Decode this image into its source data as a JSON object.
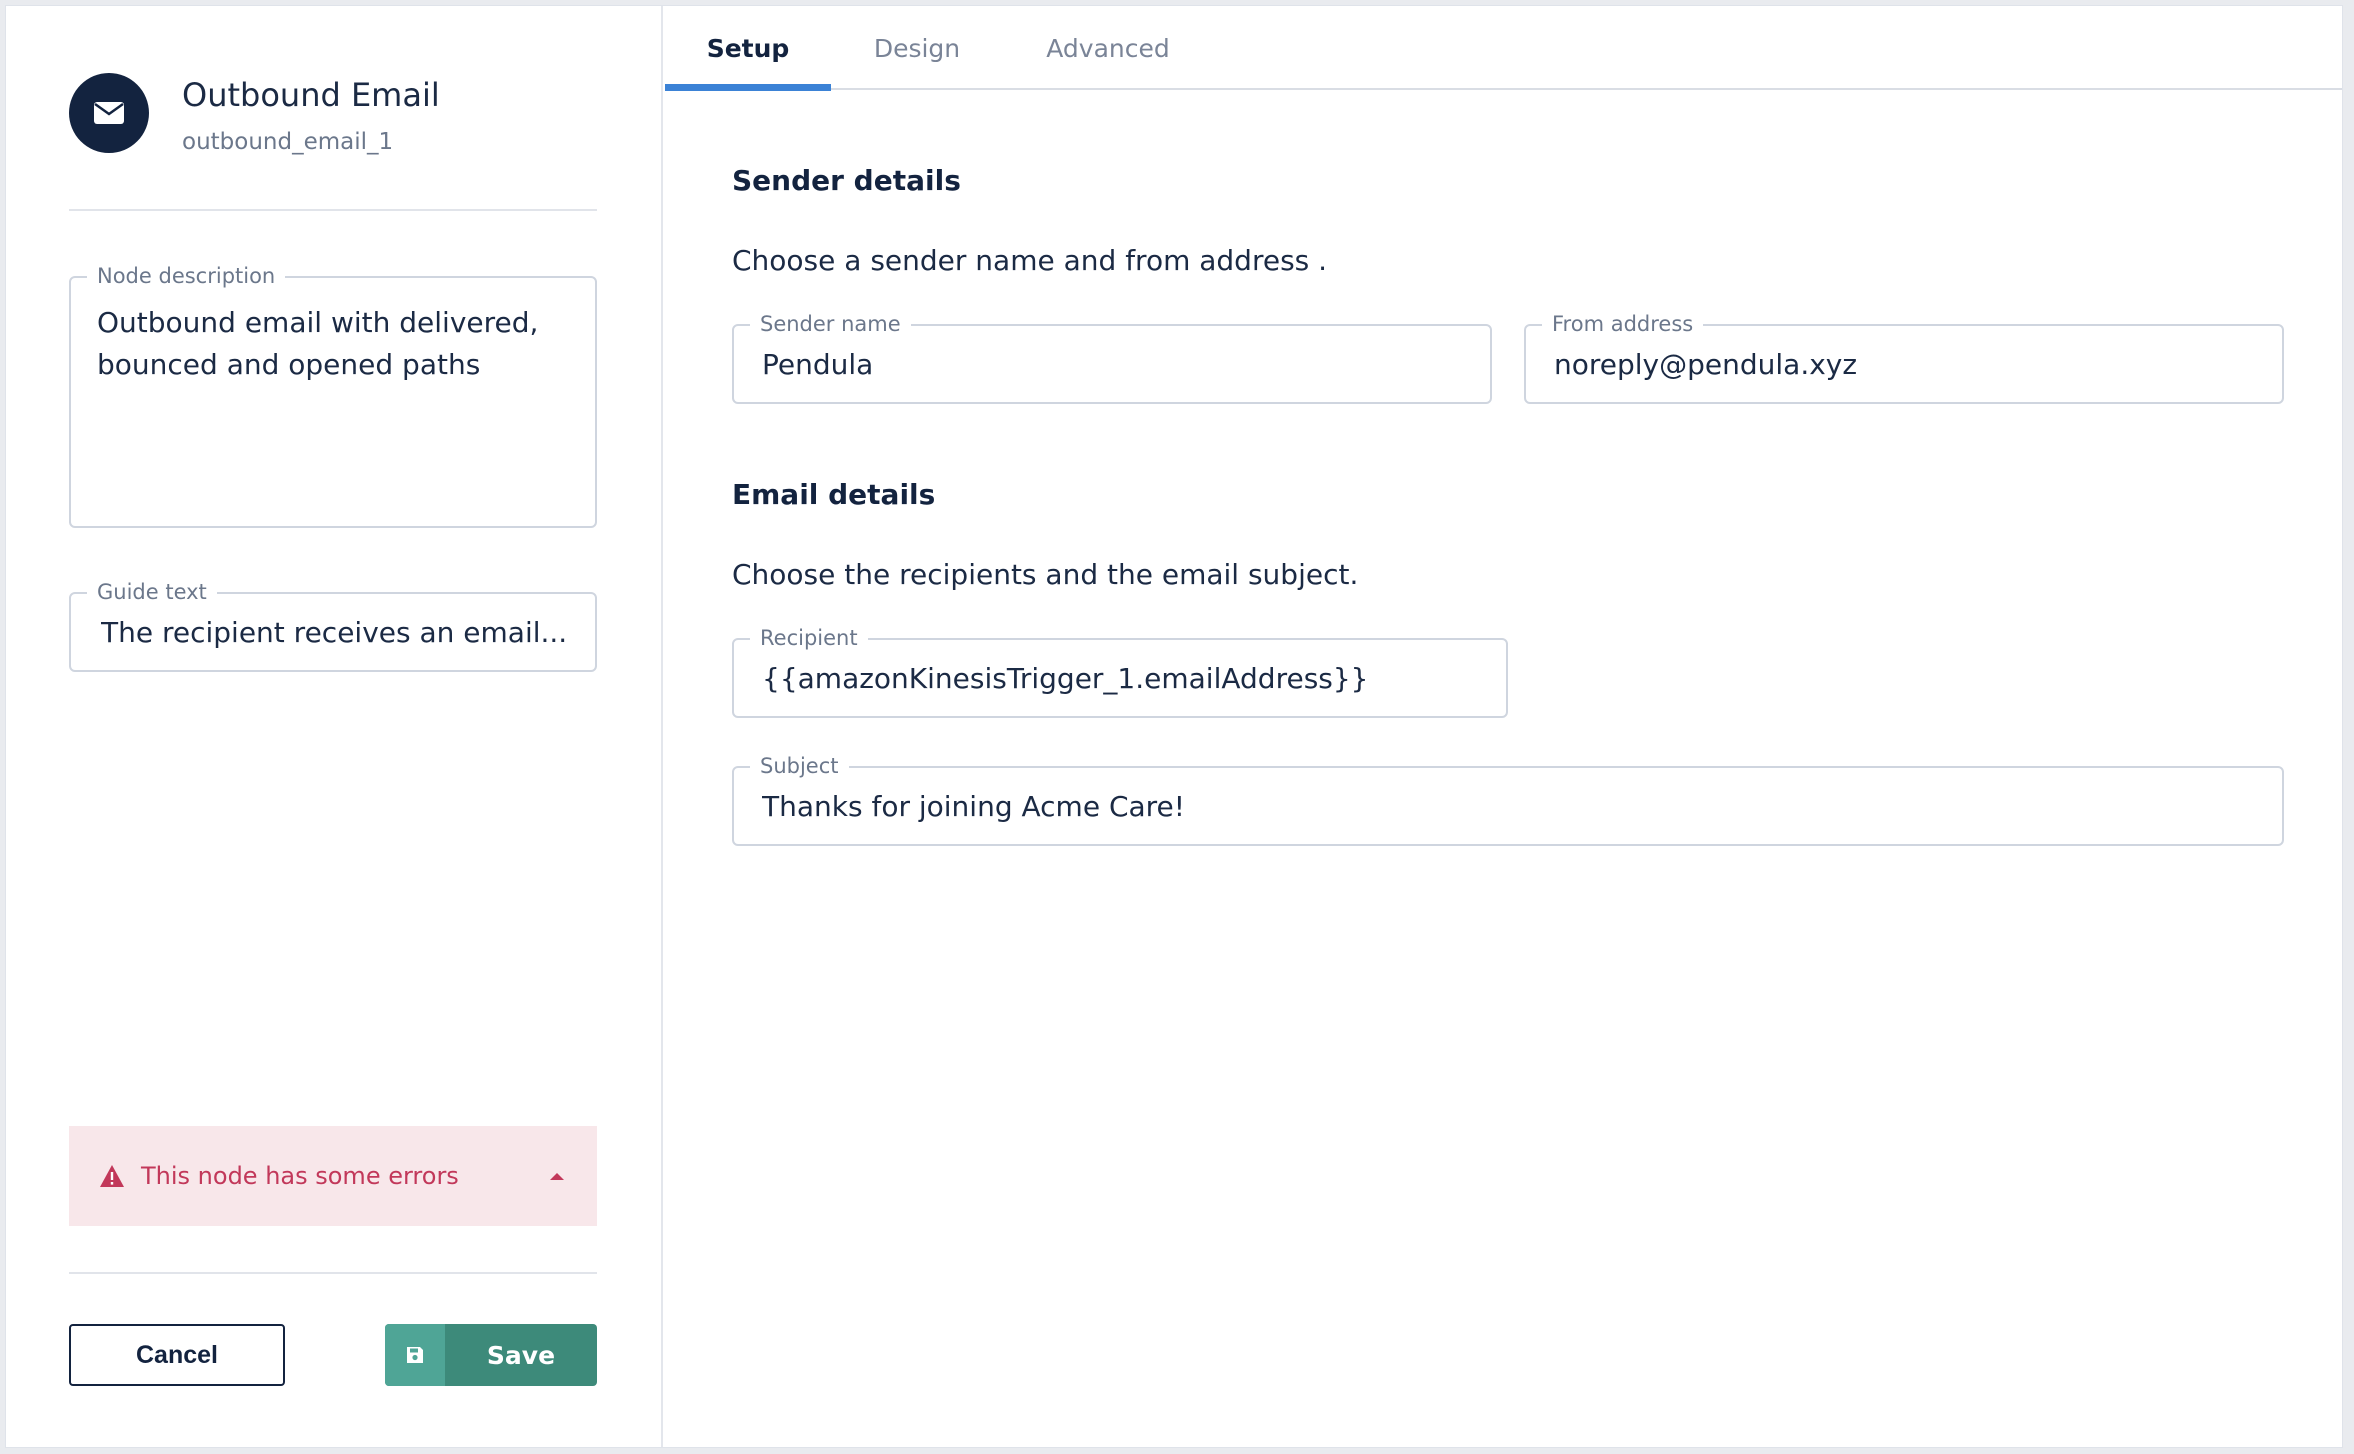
{
  "node": {
    "title": "Outbound Email",
    "id": "outbound_email_1",
    "icon": "envelope-icon"
  },
  "node_description": {
    "label": "Node description",
    "value": "Outbound email with delivered, bounced and opened paths"
  },
  "guide_text": {
    "label": "Guide text",
    "value": "The recipient receives an email..."
  },
  "error": {
    "message": "This node has some errors",
    "color": "#c2385a"
  },
  "actions": {
    "cancel_label": "Cancel",
    "save_label": "Save"
  },
  "tabs": [
    {
      "label": "Setup",
      "active": true
    },
    {
      "label": "Design",
      "active": false
    },
    {
      "label": "Advanced",
      "active": false
    }
  ],
  "sender": {
    "title": "Sender details",
    "description": "Choose a sender name and from address .",
    "name_label": "Sender name",
    "name_value": "Pendula",
    "from_label": "From address",
    "from_value": "noreply@pendula.xyz"
  },
  "email": {
    "title": "Email details",
    "description": "Choose the recipients and the email subject.",
    "recipient_label": "Recipient",
    "recipient_value": "{{amazonKinesisTrigger_1.emailAddress}}",
    "subject_label": "Subject",
    "subject_value": "Thanks for joining Acme Care!"
  },
  "colors": {
    "primary_dark": "#13233f",
    "tab_accent": "#3b82d6",
    "save_green": "#3d8a7a",
    "error_bg": "#f8e7ea"
  }
}
